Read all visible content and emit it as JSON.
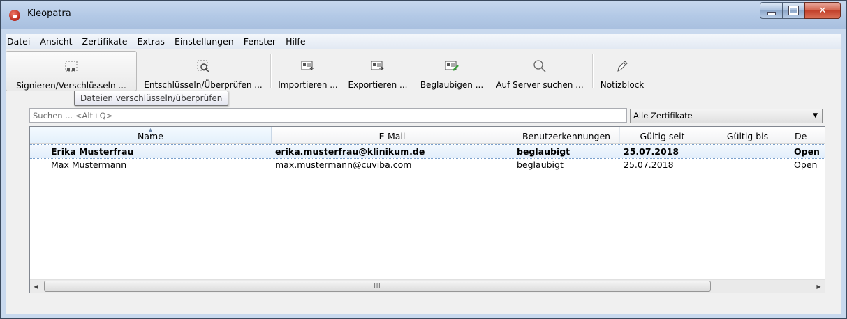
{
  "window": {
    "title": "Kleopatra"
  },
  "menu": [
    "Datei",
    "Ansicht",
    "Zertifikate",
    "Extras",
    "Einstellungen",
    "Fenster",
    "Hilfe"
  ],
  "toolbar": {
    "sign_encrypt": "Signieren/Verschlüsseln ...",
    "decrypt_verify": "Entschlüsseln/Überprüfen ...",
    "import": "Importieren ...",
    "export": "Exportieren ...",
    "certify": "Beglaubigen ...",
    "server_search": "Auf Server suchen ...",
    "notepad": "Notizblock"
  },
  "tooltip": "Dateien verschlüsseln/überprüfen",
  "search": {
    "placeholder": "Suchen ... <Alt+Q>"
  },
  "filter": {
    "selected": "Alle Zertifikate"
  },
  "table": {
    "columns": [
      "Name",
      "E-Mail",
      "Benutzerkennungen",
      "Gültig seit",
      "Gültig bis",
      "De"
    ],
    "rows": [
      {
        "name": "Erika Musterfrau",
        "email": "erika.musterfrau@klinikum.de",
        "user_ids": "beglaubigt",
        "valid_from": "25.07.2018",
        "valid_until": "",
        "details": "Open"
      },
      {
        "name": "Max Mustermann",
        "email": "max.mustermann@cuviba.com",
        "user_ids": "beglaubigt",
        "valid_from": "25.07.2018",
        "valid_until": "",
        "details": "Open"
      }
    ]
  },
  "scrollbar": {
    "thumb_label": "III"
  },
  "colors": {
    "selection": "#e2eefb",
    "titlebar": "#b3c9e6",
    "close": "#c2402a"
  }
}
